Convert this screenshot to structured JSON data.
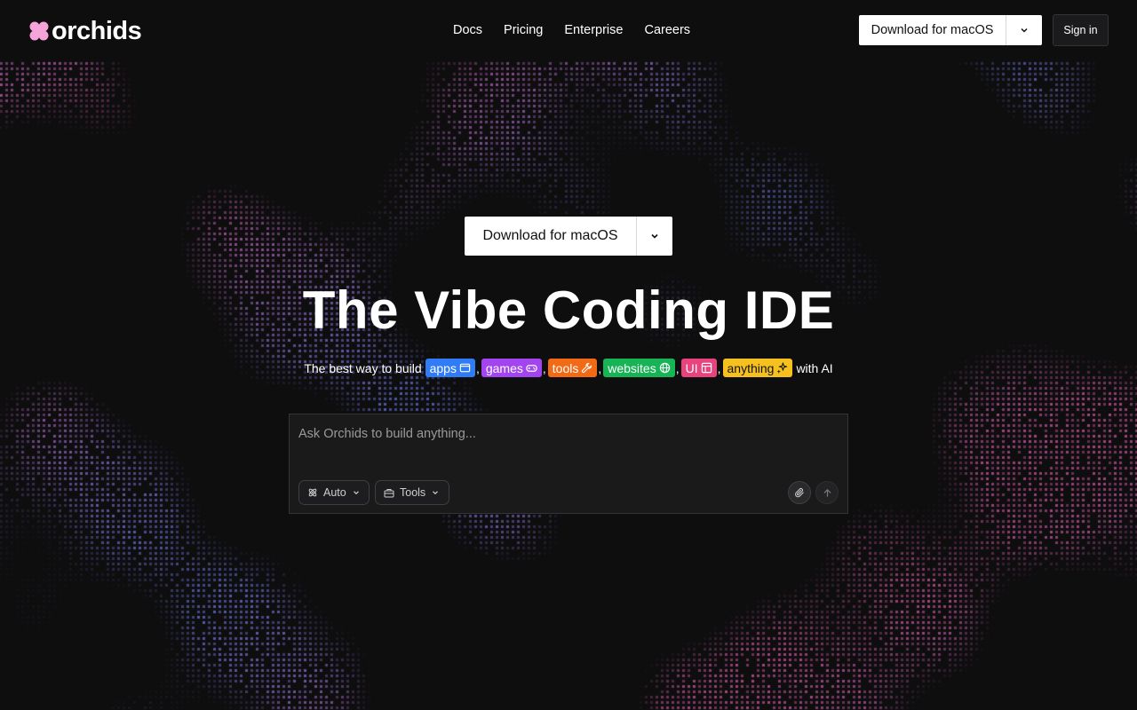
{
  "brand": {
    "name": "orchids",
    "logo_color": "#f5a3d8"
  },
  "nav": {
    "items": [
      "Docs",
      "Pricing",
      "Enterprise",
      "Careers"
    ]
  },
  "header": {
    "download_label": "Download for macOS",
    "signin_label": "Sign in"
  },
  "hero": {
    "download_label": "Download for macOS",
    "title": "The Vibe Coding IDE",
    "subtitle_prefix": "The best way to build",
    "subtitle_suffix": "with AI",
    "chips": [
      {
        "label": "apps",
        "icon": "app-window-icon",
        "color": "#2f7cf6"
      },
      {
        "label": "games",
        "icon": "gamepad-icon",
        "color": "#a244f0"
      },
      {
        "label": "tools",
        "icon": "wrench-icon",
        "color": "#f26a15"
      },
      {
        "label": "websites",
        "icon": "globe-icon",
        "color": "#16b455"
      },
      {
        "label": "UI",
        "icon": "layout-icon",
        "color": "#e8437c"
      },
      {
        "label": "anything",
        "icon": "sparkles-icon",
        "color": "#f6c01e"
      }
    ]
  },
  "prompt": {
    "placeholder": "Ask Orchids to build anything...",
    "mode_label": "Auto",
    "tools_label": "Tools"
  },
  "colors": {
    "background": "#0e0e0f",
    "panel": "#1a1a1b",
    "dot_pink": "#d88aa8",
    "dot_blue": "#7a84d8"
  }
}
